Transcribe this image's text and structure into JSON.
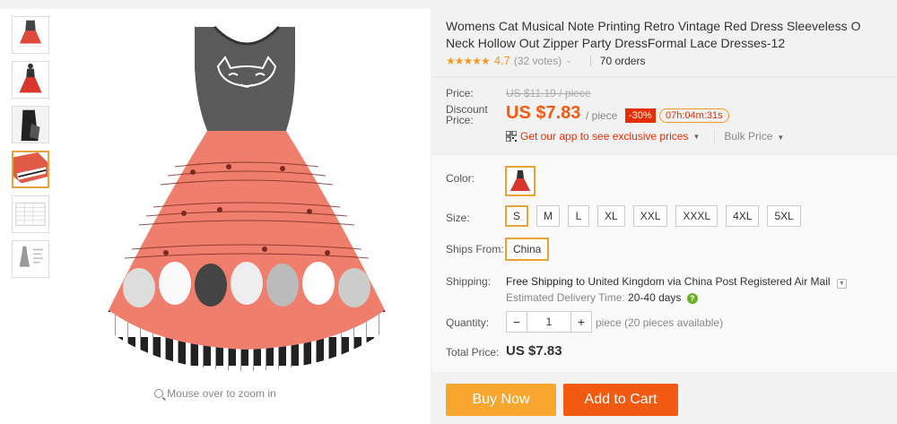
{
  "gallery": {
    "thumbnails": [
      {
        "name": "dress-front-thumb"
      },
      {
        "name": "dress-model-thumb"
      },
      {
        "name": "dress-back-thumb"
      },
      {
        "name": "dress-detail-thumb"
      },
      {
        "name": "size-chart-thumb"
      },
      {
        "name": "size-guide-thumb"
      }
    ],
    "active_index": 3,
    "zoom_hint": "Mouse over to zoom in"
  },
  "product": {
    "title": "Womens Cat Musical Note Printing Retro Vintage Red Dress Sleeveless O Neck Hollow Out Zipper Party DressFormal Lace Dresses-12",
    "stars": "★★★★★",
    "rating": "4.7",
    "votes": "(32 votes)",
    "orders": "70 orders"
  },
  "price": {
    "price_label": "Price:",
    "original": "US $11.19 / piece",
    "discount_label_1": "Discount",
    "discount_label_2": "Price:",
    "current": "US $7.83",
    "per": "/ piece",
    "discount_badge": "-30%",
    "timer": "07h:04m:31s",
    "app_promo": "Get our app to see exclusive prices",
    "bulk": "Bulk Price"
  },
  "options": {
    "color_label": "Color:",
    "size_label": "Size:",
    "sizes": [
      "S",
      "M",
      "L",
      "XL",
      "XXL",
      "XXXL",
      "4XL",
      "5XL"
    ],
    "selected_size": "S",
    "ships_from_label": "Ships From:",
    "ships_from": "China",
    "shipping_label": "Shipping:",
    "shipping_free": "Free Shipping",
    "shipping_to": "to United Kingdom via China Post Registered Air Mail",
    "eta_label": "Estimated Delivery Time:",
    "eta_days": "20-40 days",
    "quantity_label": "Quantity:",
    "quantity": "1",
    "available": "piece (20 pieces available)",
    "total_label": "Total Price:",
    "total": "US $7.83"
  },
  "actions": {
    "buy_now": "Buy Now",
    "add_to_cart": "Add to Cart"
  },
  "colors": {
    "accent_orange": "#f25a12",
    "buy_now": "#f7a62e",
    "discount_red": "#e62e04",
    "selected_border": "#e8a33a",
    "star": "#f29a1f"
  }
}
